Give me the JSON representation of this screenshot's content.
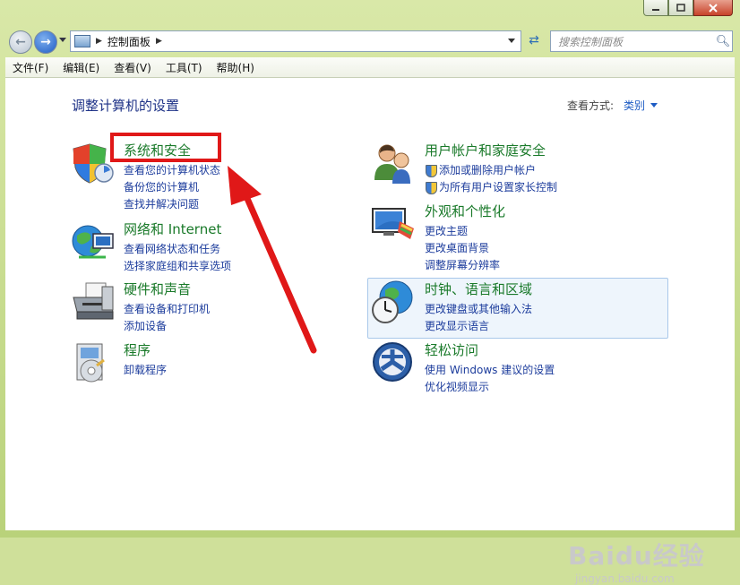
{
  "window": {
    "controls": [
      "minimize-icon",
      "maximize-icon",
      "close-icon"
    ]
  },
  "nav": {
    "address": "控制面板",
    "search_placeholder": "搜索控制面板"
  },
  "menubar": {
    "items": [
      "文件(F)",
      "编辑(E)",
      "查看(V)",
      "工具(T)",
      "帮助(H)"
    ]
  },
  "main": {
    "title": "调整计算机的设置",
    "viewby_label": "查看方式:",
    "viewby_value": "类别"
  },
  "categories_left": [
    {
      "title": "系统和安全",
      "links": [
        "查看您的计算机状态",
        "备份您的计算机",
        "查找并解决问题"
      ]
    },
    {
      "title": "网络和 Internet",
      "links": [
        "查看网络状态和任务",
        "选择家庭组和共享选项"
      ]
    },
    {
      "title": "硬件和声音",
      "links": [
        "查看设备和打印机",
        "添加设备"
      ]
    },
    {
      "title": "程序",
      "links": [
        "卸载程序"
      ]
    }
  ],
  "categories_right": [
    {
      "title": "用户帐户和家庭安全",
      "links": [
        "添加或删除用户帐户",
        "为所有用户设置家长控制"
      ]
    },
    {
      "title": "外观和个性化",
      "links": [
        "更改主题",
        "更改桌面背景",
        "调整屏幕分辨率"
      ]
    },
    {
      "title": "时钟、语言和区域",
      "links": [
        "更改键盘或其他输入法",
        "更改显示语言"
      ]
    },
    {
      "title": "轻松访问",
      "links": [
        "使用 Windows 建议的设置",
        "优化视频显示"
      ]
    }
  ],
  "watermark": {
    "main": "Baidu经验",
    "sub": "jingyan.baidu.com"
  },
  "colors": {
    "link_blue": "#1c3c9c",
    "category_green": "#1a7a2a",
    "annotation_red": "#e01818"
  }
}
